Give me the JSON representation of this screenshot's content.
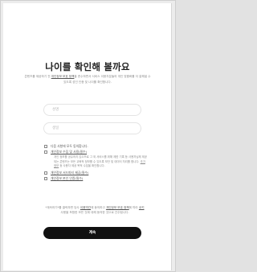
{
  "page": {
    "title": "나이를 확인해 볼까요",
    "description": {
      "part1": "콘텐츠를 제공하기 전 ",
      "link": "개인정보 보호 정책",
      "part2": "을 준수하면서 서비스 이용자분들의 개인 맞춤화를 더 잘해낼 수 있도록 성인 인증 및 나이를 확인합니다."
    }
  },
  "form": {
    "name_placeholder": "성명",
    "birth_placeholder": "생일"
  },
  "checks": {
    "all": "다음 사항에 모두 동의합니다.",
    "privacy_label": "개인정보 수집 및 사용(필수)",
    "privacy_terms": {
      "part1": "개인 정보를 공유하지 않으므로 그 외 서비스를 위해 제한 기록 등 사용자님께 제공되는 콘텐츠는 모든 교육적 정보를 수 있도록 보안 및 데이터 처리를 합니다. ",
      "link": "추가 정보",
      "part2": " 등 사용자 제공 목적 수집을 확인합니다."
    },
    "third_party_label": "개인정보 서드파티 제공(필수)",
    "identity_label": "개인정보 본인 인증(필수)"
  },
  "notice": {
    "part1": "*계속하기*를 클릭하면 당사 ",
    "link1": "이용약관",
    "part2": "에 동의하고 ",
    "link2": "개인정보 보호 정책",
    "part3": "에 따라 ",
    "link3": "쿠키",
    "part4": " 사용을 포함한 모든 것에 대해 동의한 것으로 간주됩니다."
  },
  "button": {
    "continue_label": "계속"
  }
}
